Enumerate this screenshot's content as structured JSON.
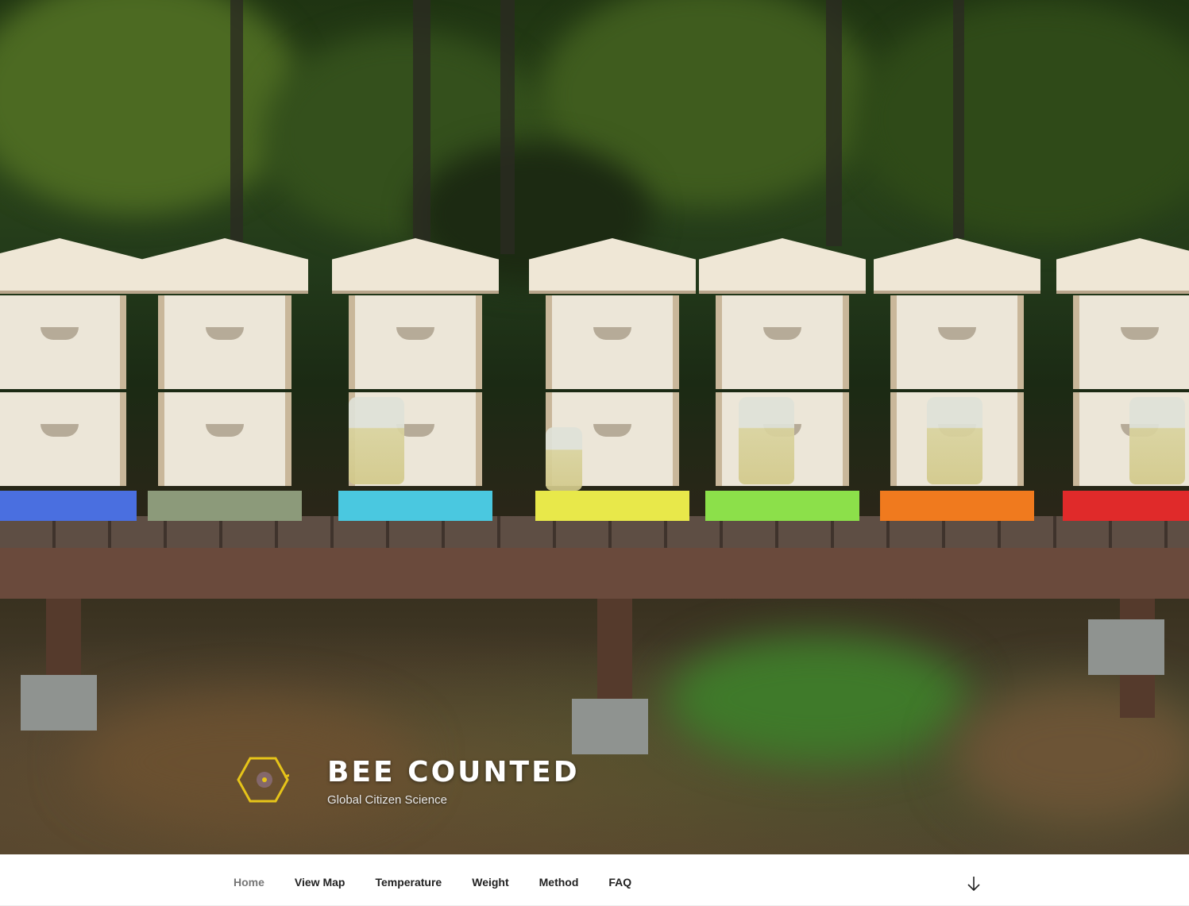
{
  "site": {
    "title": "Bee Counted",
    "tagline": "Global Citizen Science"
  },
  "navigation": {
    "items": [
      {
        "label": "Home",
        "current": true
      },
      {
        "label": "View Map",
        "current": false
      },
      {
        "label": "Temperature",
        "current": false
      },
      {
        "label": "Weight",
        "current": false
      },
      {
        "label": "Method",
        "current": false
      },
      {
        "label": "FAQ",
        "current": false
      }
    ],
    "scroll_icon": "arrow-down-icon"
  },
  "hero": {
    "image_subject": "row of beehives with feeder jars",
    "board_colors": [
      "#4a6fe0",
      "#8c9a7a",
      "#4ac8e0",
      "#e8e84a",
      "#8ce04a",
      "#f07a1e",
      "#e02a2a"
    ]
  },
  "logo": {
    "icon": "hexagon-bee-logo-icon",
    "color": "#e6c419"
  }
}
